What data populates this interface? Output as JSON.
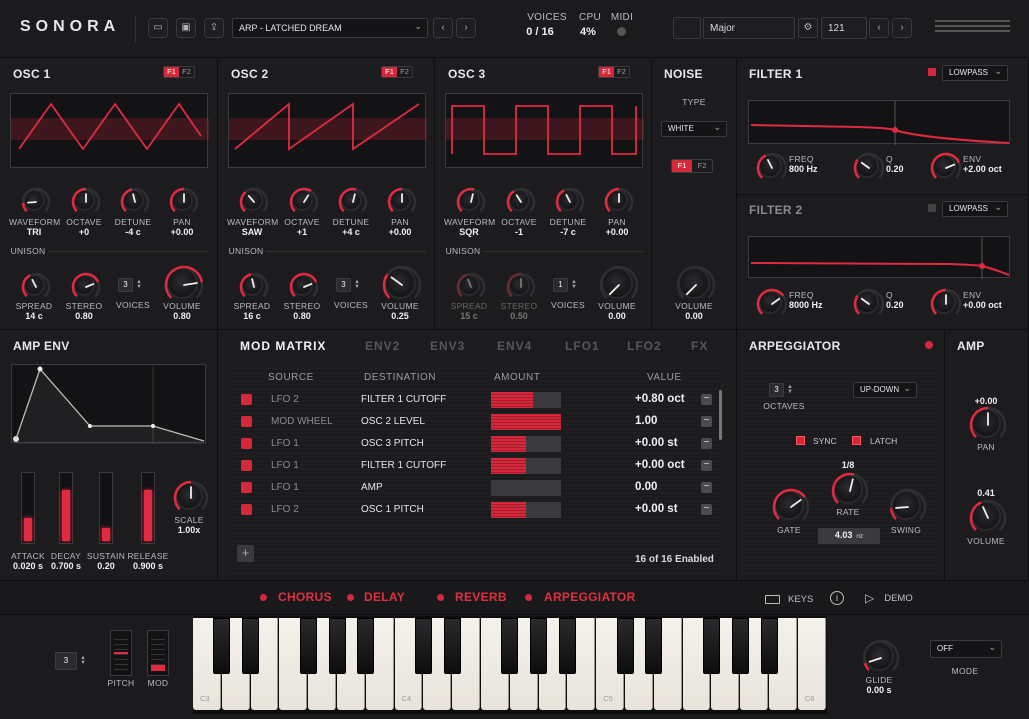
{
  "header": {
    "logo": "SONORA",
    "preset": "ARP - LATCHED DREAM",
    "voices_label": "VOICES",
    "voices_value": "0 / 16",
    "cpu_label": "CPU",
    "cpu_value": "4%",
    "midi_label": "MIDI",
    "scale": "Major",
    "tempo": "121",
    "icons": [
      "folder-icon",
      "save-icon",
      "export-icon",
      "chevron-left-icon",
      "chevron-right-icon",
      "gear-icon",
      "menu-icon"
    ]
  },
  "osc1": {
    "title": "OSC 1",
    "f1": "F1",
    "f2": "F2",
    "unison_label": "UNISON",
    "knobs": [
      {
        "label": "WAVEFORM",
        "value": "TRI"
      },
      {
        "label": "OCTAVE",
        "value": "+0"
      },
      {
        "label": "DETUNE",
        "value": "-4 c"
      },
      {
        "label": "PAN",
        "value": "+0.00"
      }
    ],
    "spread": {
      "label": "SPREAD",
      "value": "14 c"
    },
    "stereo": {
      "label": "STEREO",
      "value": "0.80"
    },
    "voices": {
      "label": "VOICES",
      "value": "3"
    },
    "volume": {
      "label": "VOLUME",
      "value": "0.80"
    }
  },
  "osc2": {
    "title": "OSC 2",
    "f1": "F1",
    "f2": "F2",
    "unison_label": "UNISON",
    "knobs": [
      {
        "label": "WAVEFORM",
        "value": "SAW"
      },
      {
        "label": "OCTAVE",
        "value": "+1"
      },
      {
        "label": "DETUNE",
        "value": "+4 c"
      },
      {
        "label": "PAN",
        "value": "+0.00"
      }
    ],
    "spread": {
      "label": "SPREAD",
      "value": "16 c"
    },
    "stereo": {
      "label": "STEREO",
      "value": "0.80"
    },
    "voices": {
      "label": "VOICES",
      "value": "3"
    },
    "volume": {
      "label": "VOLUME",
      "value": "0.25"
    }
  },
  "osc3": {
    "title": "OSC 3",
    "f1": "F1",
    "f2": "F2",
    "unison_label": "UNISON",
    "knobs": [
      {
        "label": "WAVEFORM",
        "value": "SQR"
      },
      {
        "label": "OCTAVE",
        "value": "-1"
      },
      {
        "label": "DETUNE",
        "value": "-7 c"
      },
      {
        "label": "PAN",
        "value": "+0.00"
      }
    ],
    "spread": {
      "label": "SPREAD",
      "value": "15 c"
    },
    "stereo": {
      "label": "STEREO",
      "value": "0.50"
    },
    "voices": {
      "label": "VOICES",
      "value": "1"
    },
    "volume": {
      "label": "VOLUME",
      "value": "0.00"
    }
  },
  "noise": {
    "title": "NOISE",
    "type_label": "TYPE",
    "type": "WHITE",
    "f1": "F1",
    "f2": "F2",
    "volume": {
      "label": "VOLUME",
      "value": "0.00"
    }
  },
  "filter1": {
    "title": "FILTER 1",
    "mode": "LOWPASS",
    "freq": {
      "label": "FREQ",
      "value": "800 Hz"
    },
    "q": {
      "label": "Q",
      "value": "0.20"
    },
    "env": {
      "label": "ENV",
      "value": "+2.00 oct"
    }
  },
  "filter2": {
    "title": "FILTER 2",
    "mode": "LOWPASS",
    "freq": {
      "label": "FREQ",
      "value": "8000 Hz"
    },
    "q": {
      "label": "Q",
      "value": "0.20"
    },
    "env": {
      "label": "ENV",
      "value": "+0.00 oct"
    }
  },
  "ampenv": {
    "title": "AMP ENV",
    "sliders": [
      {
        "label": "ATTACK",
        "value": "0.020 s",
        "level": 0.35
      },
      {
        "label": "DECAY",
        "value": "0.700 s",
        "level": 0.78
      },
      {
        "label": "SUSTAIN",
        "value": "0.20",
        "level": 0.2
      },
      {
        "label": "RELEASE",
        "value": "0.900 s",
        "level": 0.78
      }
    ],
    "scale": {
      "label": "SCALE",
      "value": "1.00x"
    }
  },
  "tabs": [
    "MOD MATRIX",
    "ENV2",
    "ENV3",
    "ENV4",
    "LFO1",
    "LFO2",
    "FX"
  ],
  "modmatrix": {
    "headers": [
      "SOURCE",
      "DESTINATION",
      "AMOUNT",
      "VALUE"
    ],
    "rows": [
      {
        "source": "LFO 2",
        "dest": "FILTER 1 CUTOFF",
        "value": "+0.80 oct",
        "amount": 0.6
      },
      {
        "source": "MOD WHEEL",
        "dest": "OSC 2 LEVEL",
        "value": "1.00",
        "amount": 1.0
      },
      {
        "source": "LFO 1",
        "dest": "OSC 3 PITCH",
        "value": "+0.00 st",
        "amount": 0.5
      },
      {
        "source": "LFO 1",
        "dest": "FILTER 1 CUTOFF",
        "value": "+0.00 oct",
        "amount": 0.5
      },
      {
        "source": "LFO 1",
        "dest": "AMP",
        "value": "0.00",
        "amount": 0.0
      },
      {
        "source": "LFO 2",
        "dest": "OSC 1 PITCH",
        "value": "+0.00 st",
        "amount": 0.5
      }
    ],
    "add": "+",
    "status": "16 of 16 Enabled"
  },
  "arp": {
    "title": "ARPEGGIATOR",
    "octaves": {
      "label": "OCTAVES",
      "value": "3"
    },
    "mode": "UP-DOWN",
    "sync": "SYNC",
    "latch": "LATCH",
    "gate": {
      "label": "GATE"
    },
    "rate": {
      "label": "RATE",
      "value": "1/8"
    },
    "swing": {
      "label": "SWING"
    },
    "rate_hz": "4.03",
    "hz": "HZ"
  },
  "amp": {
    "title": "AMP",
    "pan": {
      "label": "PAN",
      "value": "+0.00"
    },
    "volume": {
      "label": "VOLUME",
      "value": "0.41"
    }
  },
  "fx": {
    "items": [
      "CHORUS",
      "DELAY",
      "REVERB",
      "ARPEGGIATOR"
    ],
    "keys": "KEYS",
    "demo": "DEMO"
  },
  "keyboard": {
    "octave": "3",
    "pitch": "PITCH",
    "mod": "MOD",
    "notes": [
      "C3",
      "C4",
      "C5",
      "C6"
    ],
    "glide": {
      "label": "GLIDE",
      "value": "0.00 s"
    },
    "mode_label": "MODE",
    "mode": "OFF"
  },
  "colors": {
    "accent": "#d6283b",
    "bg": "#1a1a1d"
  }
}
